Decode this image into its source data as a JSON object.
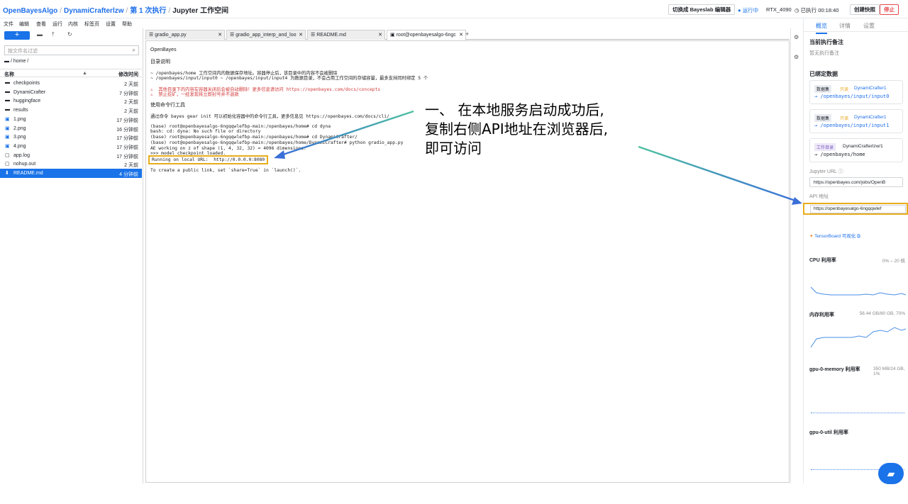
{
  "header": {
    "crumbs": [
      "OpenBayesAlgo",
      "DynamiCrafterlzw",
      "第 1 次执行"
    ],
    "current": "Jupyter 工作空间",
    "separator": "/",
    "switch_editor": "切换成 Bayeslab 编辑器",
    "status": "运行中",
    "gpu": "RTX_4090",
    "elapsed": "已执行 00:18:40",
    "snapshot": "创建快照",
    "stop": "停止"
  },
  "menu": [
    "文件",
    "编辑",
    "查看",
    "运行",
    "内核",
    "标签页",
    "设置",
    "帮助"
  ],
  "filebrowser": {
    "filter_placeholder": "按文件名过滤",
    "path": "/ home /",
    "col_name": "名称",
    "col_time": "修改时间",
    "files": [
      {
        "name": "checkpoints",
        "time": "2 天前",
        "icon": "folder-icon"
      },
      {
        "name": "DynamiCrafter",
        "time": "7 分钟前",
        "icon": "folder-icon"
      },
      {
        "name": "huggingface",
        "time": "2 天前",
        "icon": "folder-icon"
      },
      {
        "name": "results",
        "time": "2 天前",
        "icon": "folder-icon"
      },
      {
        "name": "1.png",
        "time": "17 分钟前",
        "icon": "image-icon"
      },
      {
        "name": "2.png",
        "time": "16 分钟前",
        "icon": "image-icon"
      },
      {
        "name": "3.png",
        "time": "17 分钟前",
        "icon": "image-icon"
      },
      {
        "name": "4.png",
        "time": "17 分钟前",
        "icon": "image-icon"
      },
      {
        "name": "app.log",
        "time": "17 分钟前",
        "icon": "file-icon"
      },
      {
        "name": "nohup.out",
        "time": "2 天前",
        "icon": "file-icon"
      },
      {
        "name": "README.md",
        "time": "4 分钟前",
        "icon": "markdown-icon"
      }
    ]
  },
  "tabs": [
    {
      "label": "gradio_app.py"
    },
    {
      "label": "gradio_app_interp_and_loo"
    },
    {
      "label": "README.md"
    },
    {
      "label": "root@openbayesalgo-6ngc"
    }
  ],
  "terminal": {
    "lines": [
      "OpenBayes",
      "目录说明",
      "~ /openbayes/home 工作空间内的数据保存地址。容器停止后，该目录中的内容不会被删除",
      "~ /openbayes/input/input0 ~ /openbayes/input/input4 为数据目录，不会占用工作空间的存储容量，最多支持同时绑定 5 个",
      "⚠  其他目录下的内容在容器关闭后会被自动删除！更多信息请访问 https://openbayes.com/docs/concepts",
      "⚠  禁止挖矿，一经发现将立即封号并不退款",
      "使用命令行工具",
      "通过命令 bayes gear init 可以初始化容器中的命令行工具，更多信息见 https://openbayes.com/docs/cli/",
      "(base) root@openbayesalgo-6ngqqwlefbp-main:/openbayes/home# cd dyna",
      "bash: cd: dyna: No such file or directory",
      "(base) root@openbayesalgo-6ngqqwlefbp-main:/openbayes/home# cd DynamiCrafter/",
      "(base) root@openbayesalgo-6ngqqwlefbp-main:/openbayes/home/DynamiCrafter# python gradio_app.py",
      "AE working on z of shape (1, 4, 32, 32) = 4096 dimensions.",
      ">>> model checkpoint loaded.",
      "Running on local URL:  http://0.0.0.0:8080",
      "To create a public link, set `share=True` in `launch()`."
    ]
  },
  "annotation": {
    "line1": "一、 在本地服务启动成功后,",
    "line2": "复制右侧API地址在浏览器后,",
    "line3": "即可访问",
    "arrow_color": "#3a7bd5",
    "highlight_color": "#e8ad1c"
  },
  "rightpanel": {
    "tabs": [
      "概览",
      "详情",
      "设置"
    ],
    "note_title": "当前执行备注",
    "note_empty": "暂无执行备注",
    "bound_title": "已绑定数据",
    "bindings": [
      {
        "badge": "数据集",
        "mode": "只读",
        "name": "DynamiCrafter1",
        "path": "→ /openbayes/input/input0"
      },
      {
        "badge": "数据集",
        "mode": "只读",
        "name": "DynamiCrafter1",
        "path": "→ /openbayes/input/input1"
      },
      {
        "badge": "工作目录",
        "mode": "",
        "name": "DynamiCrafterlzw/1",
        "path": "→ /openbayes/home"
      }
    ],
    "jupyter_label": "Jupyter URL",
    "jupyter_url": "https://openbayes.com/jobs/OpenB",
    "api_label": "API 地址",
    "api_url": "https://openbayesalgo-6ngqqwlef",
    "tensorboard": "TensorBoard 可视化",
    "metrics": [
      {
        "name": "CPU 利用率",
        "value": "0% – 20 核"
      },
      {
        "name": "内存利用率",
        "value": "56.44 GB/80 GB, 70%"
      },
      {
        "name": "gpu-0-memory 利用率",
        "value": "350 MB/24 GB, 1%"
      },
      {
        "name": "gpu-0-util 利用率",
        "value": ""
      }
    ]
  },
  "colors": {
    "accent": "#1a73e8",
    "arrow_green": "#4fc1a0",
    "arrow_blue": "#3a6fd8"
  }
}
